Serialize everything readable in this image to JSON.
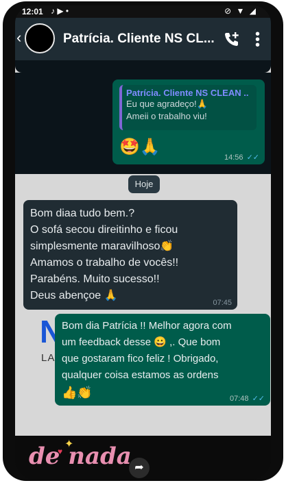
{
  "status_bar": {
    "time": "12:01",
    "left_icons": "♪ ▶ •",
    "right_icons": "⊘ ▼ ◢"
  },
  "header": {
    "back_glyph": "‹",
    "contact_name": "Patrícia.  Cliente NS CL...",
    "call_icon": "add-call-icon",
    "menu_icon": "more-vertical-icon"
  },
  "reply_message": {
    "quoted_author": "Patrícia.  Cliente NS CLEAN ..",
    "quoted_line1": "Eu que agradeço!🙏",
    "quoted_line2": "Ameii o trabalho viu!",
    "emojis": "🤩🙏",
    "time": "14:56",
    "ticks": "✓✓"
  },
  "day_separator": "Hoje",
  "incoming_message": {
    "line1": "Bom diaa tudo bem.?",
    "line2": "O sofá secou direitinho e ficou",
    "line3": "simplesmente maravilhoso👏",
    "line4": "Amamos o trabalho de vocês!!",
    "line5": "Parabéns. Muito sucesso!!",
    "line6": "Deus abençoe 🙏",
    "time": "07:45"
  },
  "outgoing_message": {
    "line1": "Bom dia Patrícia !! Melhor agora com",
    "line2": "um feedback desse 😀 ,.  Que bom",
    "line3": "que gostaram fico feliz !    Obrigado,",
    "line4": "qualquer coisa estamos as ordens",
    "emojis": "👍👏",
    "time": "07:48",
    "ticks": "✓✓"
  },
  "background_logo": {
    "letter": "N",
    "sub": "LA"
  },
  "sticker_text": "de nada",
  "share_icon": "share-arrow-icon",
  "colors": {
    "header_bg": "#1f2c34",
    "outgoing_bubble": "#005c4b",
    "incoming_bubble": "#202c33",
    "chat_bg": "#d7d7d7",
    "read_ticks": "#53bdeb"
  }
}
